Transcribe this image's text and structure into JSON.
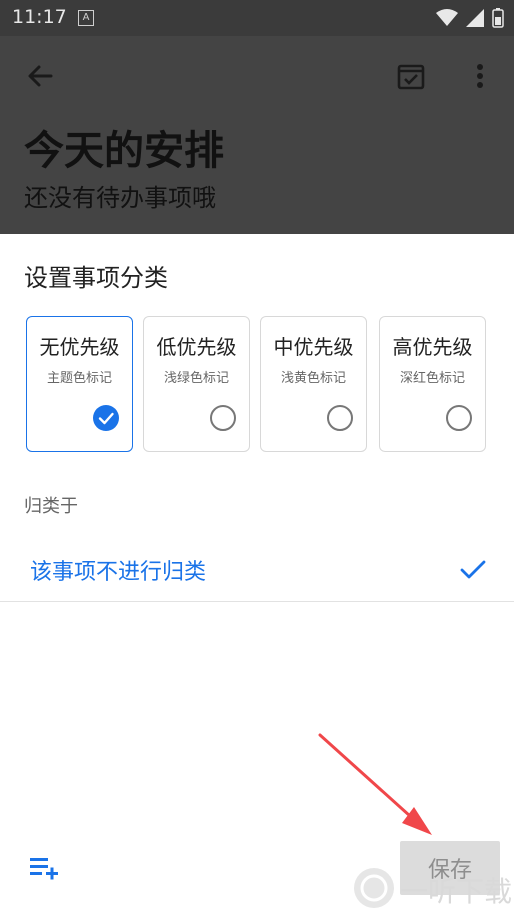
{
  "status_bar": {
    "time": "11:17",
    "notif_letter": "A"
  },
  "header": {
    "title": "今天的安排",
    "subtitle": "还没有待办事项哦"
  },
  "sheet": {
    "title": "设置事项分类",
    "priorities": [
      {
        "label": "无优先级",
        "sub": "主题色标记",
        "selected": true
      },
      {
        "label": "低优先级",
        "sub": "浅绿色标记",
        "selected": false
      },
      {
        "label": "中优先级",
        "sub": "浅黄色标记",
        "selected": false
      },
      {
        "label": "高优先级",
        "sub": "深红色标记",
        "selected": false
      }
    ],
    "group_label": "归类于",
    "group_option": "该事项不进行归类",
    "save_label": "保存"
  },
  "colors": {
    "accent": "#1a73e8",
    "annotation": "#f0474a"
  },
  "watermark": "一听下载"
}
